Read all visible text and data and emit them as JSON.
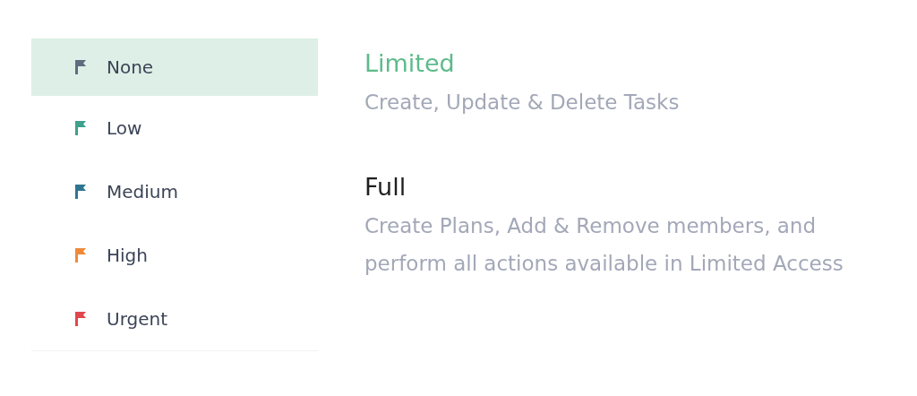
{
  "priorities": [
    {
      "label": "None",
      "color": "#5f6b7e",
      "selected": true
    },
    {
      "label": "Low",
      "color": "#3fa08c",
      "selected": false
    },
    {
      "label": "Medium",
      "color": "#2f7590",
      "selected": false
    },
    {
      "label": "High",
      "color": "#ef8a3a",
      "selected": false
    },
    {
      "label": "Urgent",
      "color": "#e0474c",
      "selected": false
    }
  ],
  "access_levels": [
    {
      "title": "Limited",
      "description": "Create, Update & Delete Tasks",
      "selected": true
    },
    {
      "title": "Full",
      "description": "Create Plans, Add & Remove members, and perform all actions available in Limited Access",
      "selected": false
    }
  ]
}
